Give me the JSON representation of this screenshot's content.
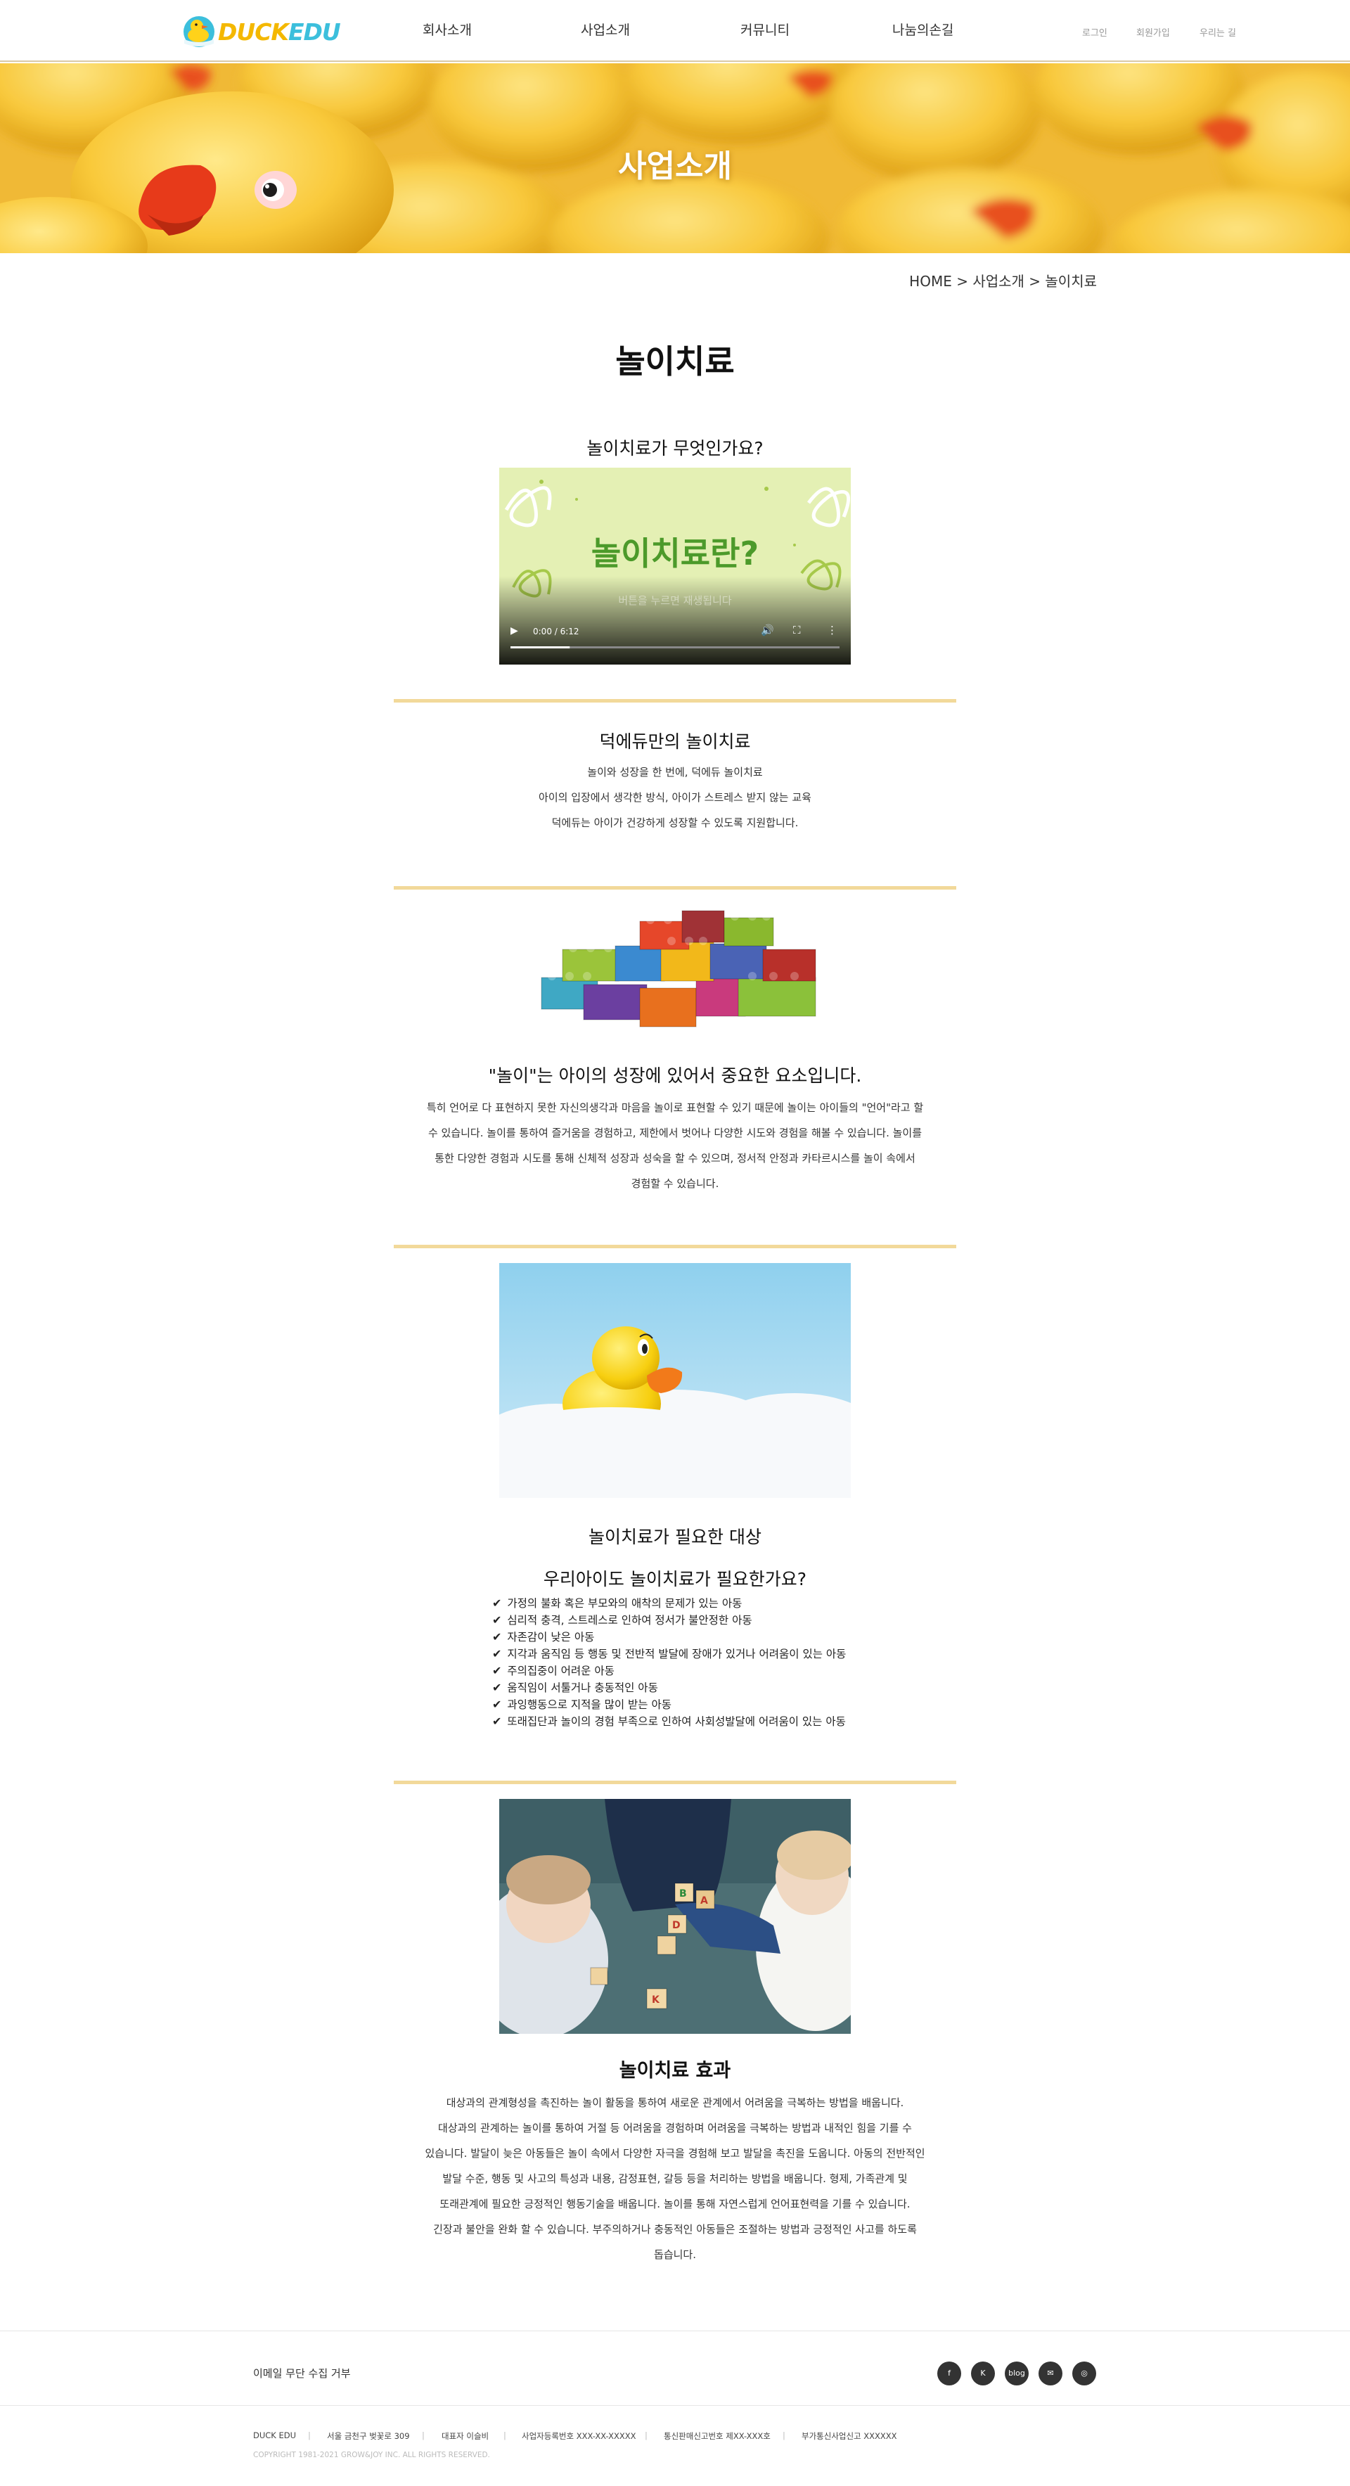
{
  "header": {
    "logo_text_duck": "DUCK",
    "logo_text_edu": "EDU",
    "nav": [
      "회사소개",
      "사업소개",
      "커뮤니티",
      "나눔의손길"
    ],
    "util": [
      "로그인",
      "회원가입",
      "우리는 길"
    ]
  },
  "hero": {
    "title": "사업소개"
  },
  "breadcrumb": "HOME > 사업소개 > 놀이치료",
  "page_title": "놀이치료",
  "sections": {
    "what": {
      "title": "놀이치료가 무엇인가요?",
      "video_title": "놀이치료란?",
      "video_hint": "버튼을 누르면 재생됩니다",
      "video_time": "0:00 / 6:12",
      "video_progress": 0.18
    },
    "duckedu": {
      "title": "덕에듀만의 놀이치료",
      "lines": [
        "놀이와 성장을 한 번에, 덕에듀 놀이치료",
        "아이의 입장에서 생각한 방식, 아이가 스트레스 받지 않는 교육",
        "덕에듀는 아이가 건강하게 성장할 수 있도록 지원합니다."
      ]
    },
    "importance": {
      "title": "\"놀이\"는 아이의 성장에 있어서 중요한 요소입니다.",
      "lines": [
        "특히 언어로 다 표현하지 못한 자신의생각과 마음을 놀이로 표현할 수 있기 때문에 놀이는 아이들의 \"언어\"라고 할",
        "수 있습니다. 놀이를 통하여 즐거움을 경험하고, 제한에서 벗어나 다양한 시도와 경험을 해볼 수 있습니다. 놀이를",
        "통한 다양한 경험과 시도를 통해 신체적 성장과 성숙을 할 수 있으며, 정서적 안정과 카타르시스를 놀이 속에서",
        "경험할 수 있습니다."
      ]
    },
    "target": {
      "title": "놀이치료가 필요한 대상",
      "subtitle": "우리아이도 놀이치료가 필요한가요?",
      "items": [
        "가정의 불화 혹은 부모와의 애착의 문제가 있는 아동",
        "심리적 충격, 스트레스로 인하여 정서가 불안정한 아동",
        "자존감이 낮은 아동",
        "지각과 움직임 등 행동 및 전반적 발달에 장애가 있거나 어려움이 있는 아동",
        "주의집중이 어려운 아동",
        "움직임이 서툴거나 충동적인 아동",
        "과잉행동으로 지적을 많이 받는 아동",
        "또래집단과 놀이의 경험 부족으로 인하여 사회성발달에 어려움이 있는 아동"
      ]
    },
    "effect": {
      "title": "놀이치료 효과",
      "lines": [
        "대상과의 관계형성을 촉진하는 놀이 활동을 통하여 새로운 관계에서 어려움을 극복하는 방법을 배웁니다.",
        "대상과의 관계하는 놀이를 통하여 거절 등 어려움을 경험하며 어려움을 극복하는 방법과 내적인 힘을 기를 수",
        "있습니다. 발달이 늦은 아동들은 놀이 속에서 다양한 자극을 경험해 보고 발달을 촉진을 도웁니다. 아동의 전반적인",
        "발달 수준, 행동 및 사고의 특성과 내용, 감정표현, 갈등 등을 처리하는 방법을 배웁니다. 형제, 가족관계 및",
        "또래관계에 필요한 긍정적인 행동기술을 배웁니다. 놀이를 통해 자연스럽게 언어표현력을 기를 수 있습니다.",
        "긴장과 불안을 완화 할 수 있습니다. 부주의하거나 충동적인 아동들은 조절하는 방법과 긍정적인 사고를 하도록",
        "돕습니다."
      ]
    }
  },
  "footer": {
    "email_notice": "이메일 무단 수집 거부",
    "social": [
      "facebook",
      "kakao",
      "blog",
      "email",
      "instagram"
    ],
    "social_labels": [
      "f",
      "K",
      "blog",
      "✉",
      "◎"
    ],
    "info": [
      "DUCK EDU",
      "서울 금천구 벚꽃로 309",
      "대표자 이슬비",
      "사업자등록번호 XXX-XX-XXXXX",
      "통신판매신고번호 제XX-XXX호",
      "부가통신사업신고 XXXXXX"
    ],
    "copyright": "COPYRIGHT 1981-2021 GROW&JOY INC. ALL RIGHTS RESERVED."
  },
  "colors": {
    "accent_yellow": "#f4b800",
    "divider": "#f2d99a",
    "logo_blue": "#3cbfdc"
  }
}
